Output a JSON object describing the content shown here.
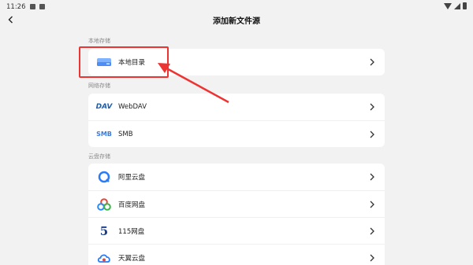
{
  "status_bar": {
    "time": "11:26"
  },
  "app_bar": {
    "title": "添加新文件源"
  },
  "sections": {
    "local": {
      "label": "本地存储",
      "items": [
        {
          "label": "本地目录",
          "icon": "local-drive-icon"
        }
      ]
    },
    "network": {
      "label": "网络存储",
      "items": [
        {
          "label": "WebDAV",
          "icon": "dav-icon",
          "icon_text": "DAV"
        },
        {
          "label": "SMB",
          "icon": "smb-icon",
          "icon_text": "SMB"
        }
      ]
    },
    "cloud": {
      "label": "云盘存储",
      "items": [
        {
          "label": "阿里云盘",
          "icon": "aliyun-drive-icon"
        },
        {
          "label": "百度网盘",
          "icon": "baidu-netdisk-icon"
        },
        {
          "label": "115网盘",
          "icon": "115-drive-icon",
          "icon_text": "5"
        },
        {
          "label": "天翼云盘",
          "icon": "tianyi-cloud-icon"
        }
      ]
    }
  },
  "colors": {
    "annotation": "#e33333",
    "dav_blue": "#1a5fb4",
    "smb_blue": "#3c7be0"
  }
}
